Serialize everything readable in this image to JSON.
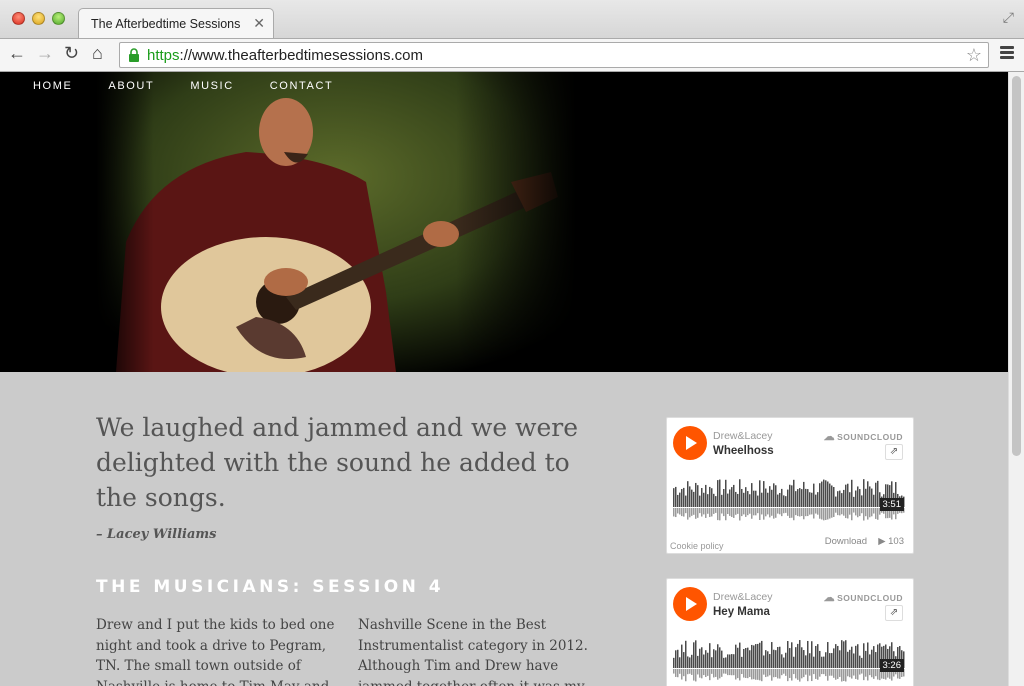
{
  "browser": {
    "tab_title": "The Afterbedtime Sessions",
    "url_scheme": "https",
    "url_rest": "://www.theafterbedtimesessions.com"
  },
  "site_nav": [
    "HOME",
    "ABOUT",
    "MUSIC",
    "CONTACT"
  ],
  "quote": {
    "text": "We laughed and jammed and we were delighted with the sound he added to the songs.",
    "author": "– Lacey Williams"
  },
  "section_title": "The Musicians: Session 4",
  "columns": [
    "Drew and I put the kids to bed one night and took a drive to Pegram, TN. The small town outside of Nashville is home to Tim May and his music shop.",
    "Nashville Scene in the Best Instrumentalist category in 2012. Although Tim and Drew have jammed together often it was my first time"
  ],
  "widgets": [
    {
      "user": "Drew&Lacey",
      "track": "Wheelhoss",
      "duration": "3:51",
      "logo": "SOUNDCLOUD",
      "cookie": "Cookie policy",
      "download": "Download",
      "plays": "103"
    },
    {
      "user": "Drew&Lacey",
      "track": "Hey Mama",
      "duration": "3:26",
      "logo": "SOUNDCLOUD"
    }
  ]
}
